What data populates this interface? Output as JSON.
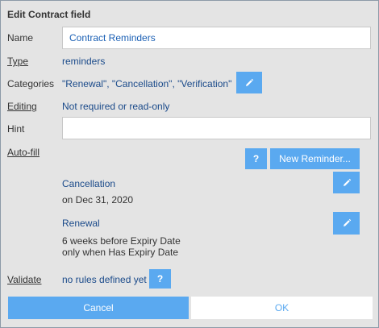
{
  "dialog": {
    "title": "Edit Contract field"
  },
  "fields": {
    "name_label": "Name",
    "name_value": "Contract Reminders",
    "type_label": "Type",
    "type_value": "reminders",
    "categories_label": "Categories",
    "categories_value": "\"Renewal\", \"Cancellation\", \"Verification\"",
    "editing_label": "Editing",
    "editing_value": "Not required or read-only",
    "hint_label": "Hint",
    "hint_value": "",
    "autofill_label": "Auto-fill",
    "help_button": "?",
    "new_reminder_button": "New Reminder...",
    "validate_label": "Validate",
    "validate_value": "no rules defined yet"
  },
  "reminders": [
    {
      "title": "Cancellation",
      "detail_line1": "on Dec 31, 2020",
      "detail_line2": ""
    },
    {
      "title": "Renewal",
      "detail_line1": "6 weeks before Expiry Date",
      "detail_line2": "only when Has Expiry Date"
    }
  ],
  "footer": {
    "cancel_label": "Cancel",
    "ok_label": "OK"
  },
  "colors": {
    "accent": "#5aa9f0",
    "background": "#e4e4e4",
    "value_text": "#1a4a8a"
  },
  "icons": {
    "edit": "pencil-icon"
  }
}
